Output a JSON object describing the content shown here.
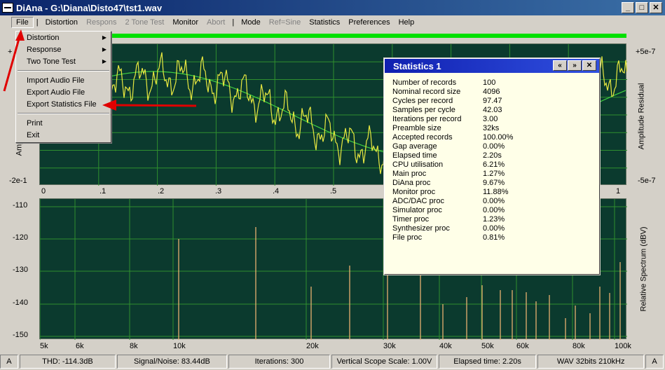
{
  "window": {
    "title": "DiAna - G:\\Diana\\Disto47\\tst1.wav"
  },
  "window_buttons": {
    "minimize": "_",
    "maximize": "□",
    "close": "✕"
  },
  "menubar": {
    "items": [
      {
        "label": "File",
        "enabled": true,
        "active": true
      },
      {
        "label": "|",
        "sep": true
      },
      {
        "label": "Distortion",
        "enabled": true
      },
      {
        "label": "Respons",
        "enabled": false
      },
      {
        "label": "2 Tone Test",
        "enabled": false
      },
      {
        "label": "Monitor",
        "enabled": true
      },
      {
        "label": "Abort",
        "enabled": false
      },
      {
        "label": "|",
        "sep": true
      },
      {
        "label": "Mode",
        "enabled": true
      },
      {
        "label": "Ref=Sine",
        "enabled": false
      },
      {
        "label": "Statistics",
        "enabled": true
      },
      {
        "label": "Preferences",
        "enabled": true
      },
      {
        "label": "Help",
        "enabled": true
      }
    ]
  },
  "file_menu": {
    "items": [
      {
        "label": "Distortion",
        "submenu": true
      },
      {
        "label": "Response",
        "submenu": true
      },
      {
        "label": "Two Tone Test",
        "submenu": true
      },
      {
        "sep": true
      },
      {
        "label": "Import Audio File"
      },
      {
        "label": "Export Audio File"
      },
      {
        "label": "Export Statistics File"
      },
      {
        "sep": true
      },
      {
        "label": "Print"
      },
      {
        "label": "Exit"
      }
    ]
  },
  "upper_plot": {
    "left_top_label": "+",
    "left_bottom_label": "-2e-1",
    "left_axis_label": "Amp",
    "right_top_label": "+5e-7",
    "right_bottom_label": "-5e-7",
    "right_axis_label": "Amplitude Residual",
    "x_ticks": [
      "0",
      ".1",
      ".2",
      ".3",
      ".4",
      ".5",
      "1"
    ]
  },
  "lower_plot": {
    "y_ticks": [
      "-110",
      "-120",
      "-130",
      "-140",
      "-150"
    ],
    "right_axis_label": "Relative Spectrum (dBV)",
    "x_ticks": [
      "5k",
      "6k",
      "8k",
      "10k",
      "20k",
      "30k",
      "40k",
      "50k",
      "60k",
      "80k",
      "100k"
    ]
  },
  "statistics": {
    "title": "Statistics 1",
    "buttons": {
      "prev": "«",
      "next": "»",
      "close": "✕"
    },
    "rows": [
      {
        "k": "Number of records",
        "v": "100"
      },
      {
        "k": "Nominal record size",
        "v": "4096"
      },
      {
        "k": "Cycles per record",
        "v": "97.47"
      },
      {
        "k": "Samples per cycle",
        "v": "42.03"
      },
      {
        "k": "Iterations per record",
        "v": "3.00"
      },
      {
        "k": "Preamble size",
        "v": "32ks"
      },
      {
        "k": "Accepted records",
        "v": "100.00%"
      },
      {
        "k": "Gap average",
        "v": "0.00%"
      },
      {
        "k": "Elapsed time",
        "v": "2.20s"
      },
      {
        "k": "CPU utilisation",
        "v": "6.21%"
      },
      {
        "k": "Main proc",
        "v": "1.27%"
      },
      {
        "k": "DiAna proc",
        "v": "9.67%"
      },
      {
        "k": "Monitor proc",
        "v": "11.88%"
      },
      {
        "k": "ADC/DAC proc",
        "v": "0.00%"
      },
      {
        "k": "Simulator proc",
        "v": "0.00%"
      },
      {
        "k": "Timer proc",
        "v": "1.23%"
      },
      {
        "k": "Synthesizer proc",
        "v": "0.00%"
      },
      {
        "k": "File proc",
        "v": "0.81%"
      }
    ]
  },
  "statusbar": {
    "left": "A",
    "thd": "THD: -114.3dB",
    "snr": "Signal/Noise:  83.44dB",
    "iterations": "Iterations: 300",
    "scope": "Vertical Scope Scale: 1.00V",
    "elapsed": "Elapsed time: 2.20s",
    "format": "WAV 32bits 210kHz",
    "right": "A"
  },
  "colors": {
    "plot_bg": "#0b3a2e",
    "grid": "#2f8f2f",
    "trace_yellow": "#e8e840",
    "trace_green": "#40d040",
    "spectrum_lines": "#e8b070",
    "arrow_red": "#e00000",
    "progress_green": "#00e000"
  }
}
